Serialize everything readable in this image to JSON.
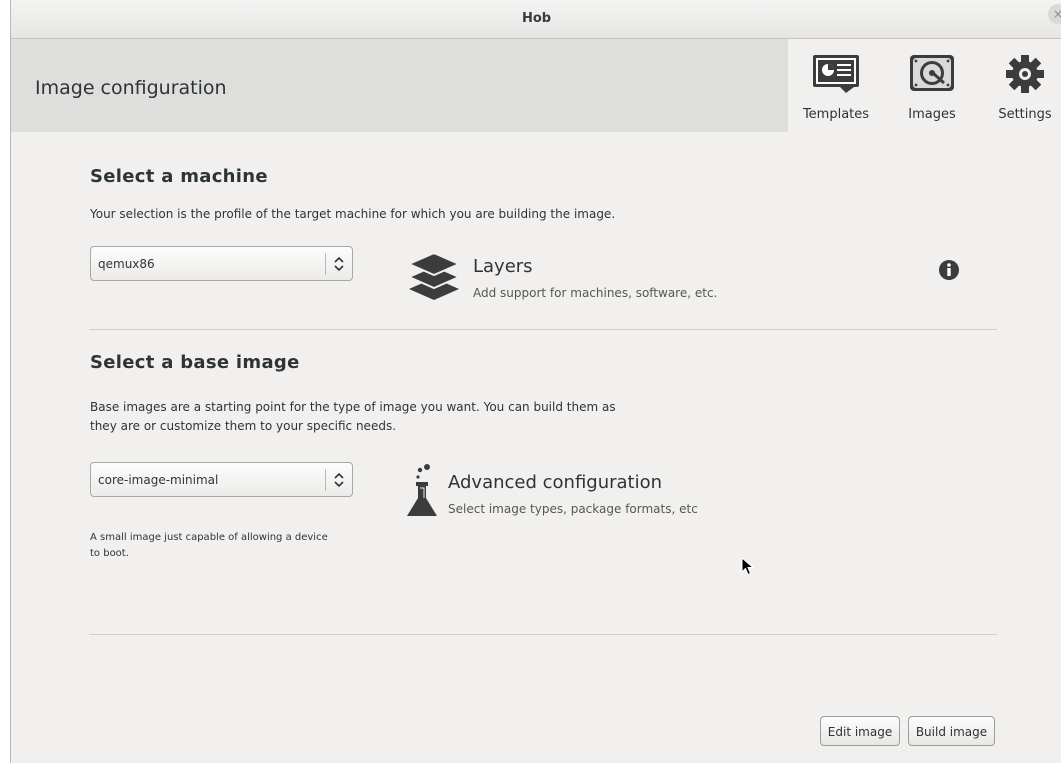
{
  "window": {
    "title": "Hob",
    "close_glyph": "×"
  },
  "header": {
    "title": "Image configuration"
  },
  "toolbar": {
    "items": [
      {
        "label": "Templates",
        "icon": "templates-icon"
      },
      {
        "label": "Images",
        "icon": "hard-disk-icon"
      },
      {
        "label": "Settings",
        "icon": "gear-icon"
      }
    ]
  },
  "machine": {
    "heading": "Select a machine",
    "description": "Your selection is the profile of the target machine for which you are building the image.",
    "selected": "qemux86"
  },
  "layers": {
    "title": "Layers",
    "subtitle": "Add support for machines, software, etc.",
    "icon": "layers-icon",
    "info_icon": "info-icon"
  },
  "base_image": {
    "heading": "Select a base image",
    "description_line1": "Base images are a starting point for the type of image you want. You can build them as",
    "description_line2": "they are or customize them to your specific needs.",
    "selected": "core-image-minimal",
    "note_line1": "A small image just capable of allowing a device",
    "note_line2": "to boot."
  },
  "advanced": {
    "title": "Advanced configuration",
    "subtitle": "Select image types, package formats, etc",
    "icon": "flask-icon"
  },
  "buttons": {
    "edit": "Edit image",
    "build": "Build image"
  },
  "colors": {
    "text": "#2e3436",
    "background": "#f1f0ee",
    "header": "#dededc"
  }
}
